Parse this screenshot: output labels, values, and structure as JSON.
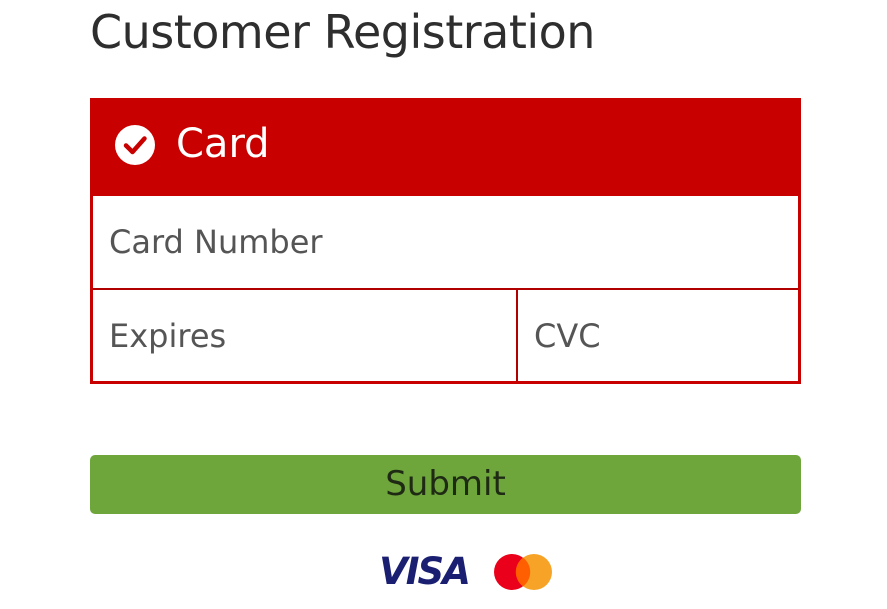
{
  "page": {
    "title": "Customer Registration"
  },
  "payment_panel": {
    "selected": true,
    "method_label": "Card",
    "icons": {
      "selected_indicator": "check-circle-icon"
    },
    "fields": {
      "card_number": {
        "value": "",
        "placeholder": "Card Number"
      },
      "expires": {
        "value": "",
        "placeholder": "Expires"
      },
      "cvc": {
        "value": "",
        "placeholder": "CVC"
      }
    }
  },
  "actions": {
    "submit_label": "Submit"
  },
  "card_brands": {
    "visa": {
      "text": "VISA",
      "icon": "visa-logo"
    },
    "mastercard": {
      "icon": "mastercard-logo"
    }
  },
  "colors": {
    "panel_accent": "#c80000",
    "submit_background": "#6ea63b",
    "visa_blue": "#1a1f71",
    "mastercard_red": "#eb001b",
    "mastercard_orange": "#f79e1b"
  }
}
